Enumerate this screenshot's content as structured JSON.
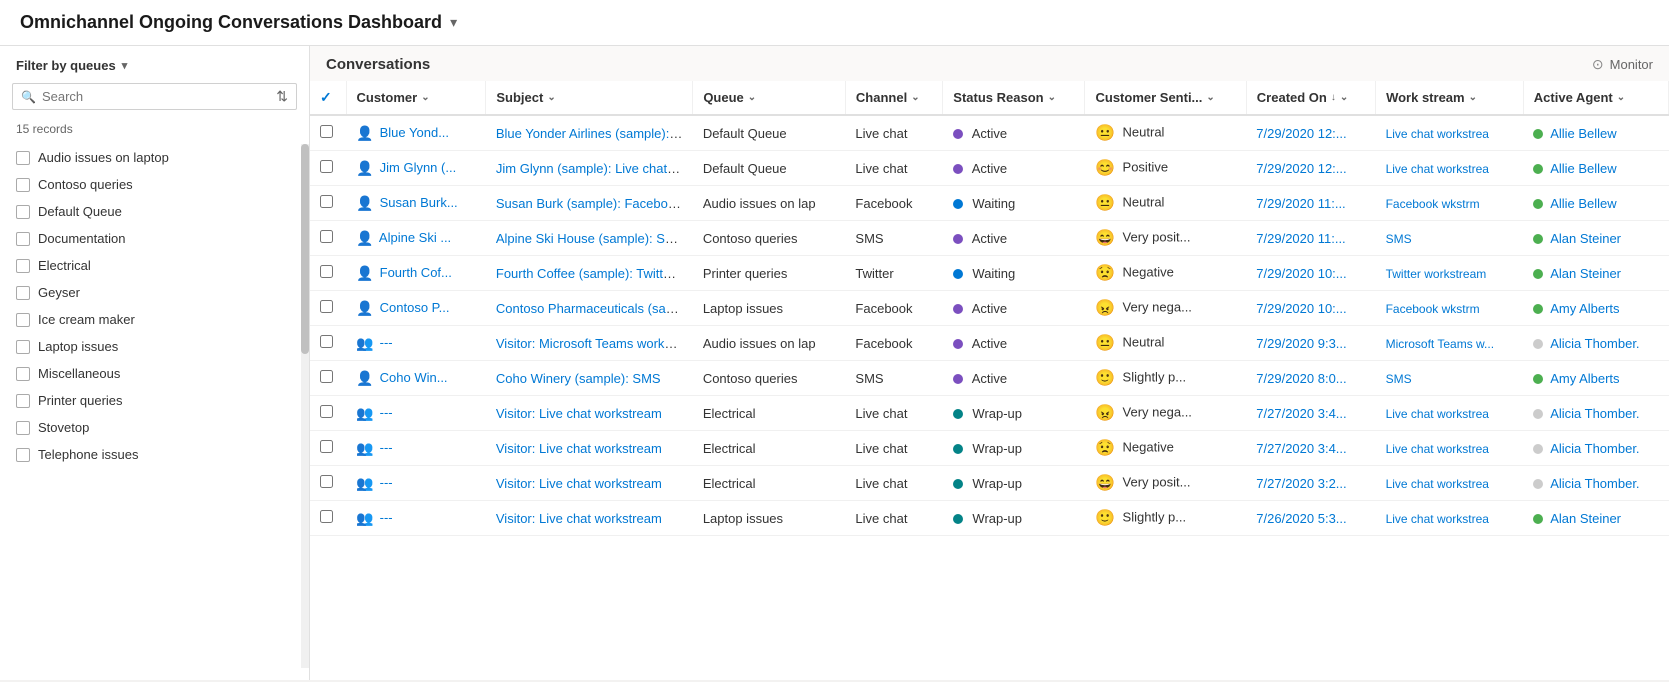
{
  "header": {
    "title": "Omnichannel Ongoing Conversations Dashboard",
    "chevron": "▾"
  },
  "sidebar": {
    "filter_label": "Filter by queues",
    "filter_chevron": "▾",
    "search_placeholder": "Search",
    "records_count": "15 records",
    "queues": [
      "Audio issues on laptop",
      "Contoso queries",
      "Default Queue",
      "Documentation",
      "Electrical",
      "Geyser",
      "Ice cream maker",
      "Laptop issues",
      "Miscellaneous",
      "Printer queries",
      "Stovetop",
      "Telephone issues"
    ]
  },
  "conversations": {
    "title": "Conversations",
    "monitor_label": "Monitor",
    "columns": {
      "customer": "Customer",
      "subject": "Subject",
      "queue": "Queue",
      "channel": "Channel",
      "status_reason": "Status Reason",
      "customer_sentiment": "Customer Senti...",
      "created_on": "Created On",
      "work_stream": "Work stream",
      "active_agent": "Active Agent"
    },
    "rows": [
      {
        "customer_icon": "person",
        "customer": "Blue Yond...",
        "subject": "Blue Yonder Airlines (sample): Live c...",
        "queue": "Default Queue",
        "channel": "Live chat",
        "status_dot": "purple",
        "status": "Active",
        "sentiment_type": "neutral",
        "sentiment_label": "Neutral",
        "created_on": "7/29/2020 12:...",
        "workstream": "Live chat workstrea",
        "agent_active": true,
        "agent": "Allie Bellew"
      },
      {
        "customer_icon": "person",
        "customer": "Jim Glynn (...",
        "subject": "Jim Glynn (sample): Live chat works",
        "queue": "Default Queue",
        "channel": "Live chat",
        "status_dot": "purple",
        "status": "Active",
        "sentiment_type": "positive",
        "sentiment_label": "Positive",
        "created_on": "7/29/2020 12:...",
        "workstream": "Live chat workstrea",
        "agent_active": true,
        "agent": "Allie Bellew"
      },
      {
        "customer_icon": "person",
        "customer": "Susan Burk...",
        "subject": "Susan Burk (sample): Facebook wor",
        "queue": "Audio issues on lap",
        "channel": "Facebook",
        "status_dot": "blue",
        "status": "Waiting",
        "sentiment_type": "neutral",
        "sentiment_label": "Neutral",
        "created_on": "7/29/2020 11:...",
        "workstream": "Facebook wkstrm",
        "agent_active": true,
        "agent": "Allie Bellew"
      },
      {
        "customer_icon": "person",
        "customer": "Alpine Ski ...",
        "subject": "Alpine Ski House (sample): SMS",
        "queue": "Contoso queries",
        "channel": "SMS",
        "status_dot": "purple",
        "status": "Active",
        "sentiment_type": "verypositive",
        "sentiment_label": "Very posit...",
        "created_on": "7/29/2020 11:...",
        "workstream": "SMS",
        "agent_active": true,
        "agent": "Alan Steiner"
      },
      {
        "customer_icon": "person",
        "customer": "Fourth Cof...",
        "subject": "Fourth Coffee (sample): Twitter wor",
        "queue": "Printer queries",
        "channel": "Twitter",
        "status_dot": "blue",
        "status": "Waiting",
        "sentiment_type": "negative",
        "sentiment_label": "Negative",
        "created_on": "7/29/2020 10:...",
        "workstream": "Twitter workstream",
        "agent_active": true,
        "agent": "Alan Steiner"
      },
      {
        "customer_icon": "person",
        "customer": "Contoso P...",
        "subject": "Contoso Pharmaceuticals (sample):",
        "queue": "Laptop issues",
        "channel": "Facebook",
        "status_dot": "purple",
        "status": "Active",
        "sentiment_type": "verynegative",
        "sentiment_label": "Very nega...",
        "created_on": "7/29/2020 10:...",
        "workstream": "Facebook wkstrm",
        "agent_active": true,
        "agent": "Amy Alberts"
      },
      {
        "customer_icon": "visitor",
        "customer": "---",
        "subject": "Visitor: Microsoft Teams workstream",
        "queue": "Audio issues on lap",
        "channel": "Facebook",
        "status_dot": "purple",
        "status": "Active",
        "sentiment_type": "neutral",
        "sentiment_label": "Neutral",
        "created_on": "7/29/2020 9:3...",
        "workstream": "Microsoft Teams w...",
        "agent_active": false,
        "agent": "Alicia Thomber."
      },
      {
        "customer_icon": "person",
        "customer": "Coho Win...",
        "subject": "Coho Winery (sample): SMS",
        "queue": "Contoso queries",
        "channel": "SMS",
        "status_dot": "purple",
        "status": "Active",
        "sentiment_type": "slightlypositive",
        "sentiment_label": "Slightly p...",
        "created_on": "7/29/2020 8:0...",
        "workstream": "SMS",
        "agent_active": true,
        "agent": "Amy Alberts"
      },
      {
        "customer_icon": "visitor",
        "customer": "---",
        "subject": "Visitor: Live chat workstream",
        "queue": "Electrical",
        "channel": "Live chat",
        "status_dot": "teal",
        "status": "Wrap-up",
        "sentiment_type": "verynegative",
        "sentiment_label": "Very nega...",
        "created_on": "7/27/2020 3:4...",
        "workstream": "Live chat workstrea",
        "agent_active": false,
        "agent": "Alicia Thomber."
      },
      {
        "customer_icon": "visitor",
        "customer": "---",
        "subject": "Visitor: Live chat workstream",
        "queue": "Electrical",
        "channel": "Live chat",
        "status_dot": "teal",
        "status": "Wrap-up",
        "sentiment_type": "negative",
        "sentiment_label": "Negative",
        "created_on": "7/27/2020 3:4...",
        "workstream": "Live chat workstrea",
        "agent_active": false,
        "agent": "Alicia Thomber."
      },
      {
        "customer_icon": "visitor",
        "customer": "---",
        "subject": "Visitor: Live chat workstream",
        "queue": "Electrical",
        "channel": "Live chat",
        "status_dot": "teal",
        "status": "Wrap-up",
        "sentiment_type": "verypositive",
        "sentiment_label": "Very posit...",
        "created_on": "7/27/2020 3:2...",
        "workstream": "Live chat workstrea",
        "agent_active": false,
        "agent": "Alicia Thomber."
      },
      {
        "customer_icon": "visitor",
        "customer": "---",
        "subject": "Visitor: Live chat workstream",
        "queue": "Laptop issues",
        "channel": "Live chat",
        "status_dot": "teal",
        "status": "Wrap-up",
        "sentiment_type": "slightlypositive",
        "sentiment_label": "Slightly p...",
        "created_on": "7/26/2020 5:3...",
        "workstream": "Live chat workstrea",
        "agent_active": true,
        "agent": "Alan Steiner"
      }
    ]
  },
  "icons": {
    "person": "👤",
    "visitor": "👥",
    "monitor": "⊙",
    "sort": "⇅",
    "search": "🔍",
    "chevron_down": "⌄",
    "check": "✓",
    "sort_down": "↓"
  }
}
